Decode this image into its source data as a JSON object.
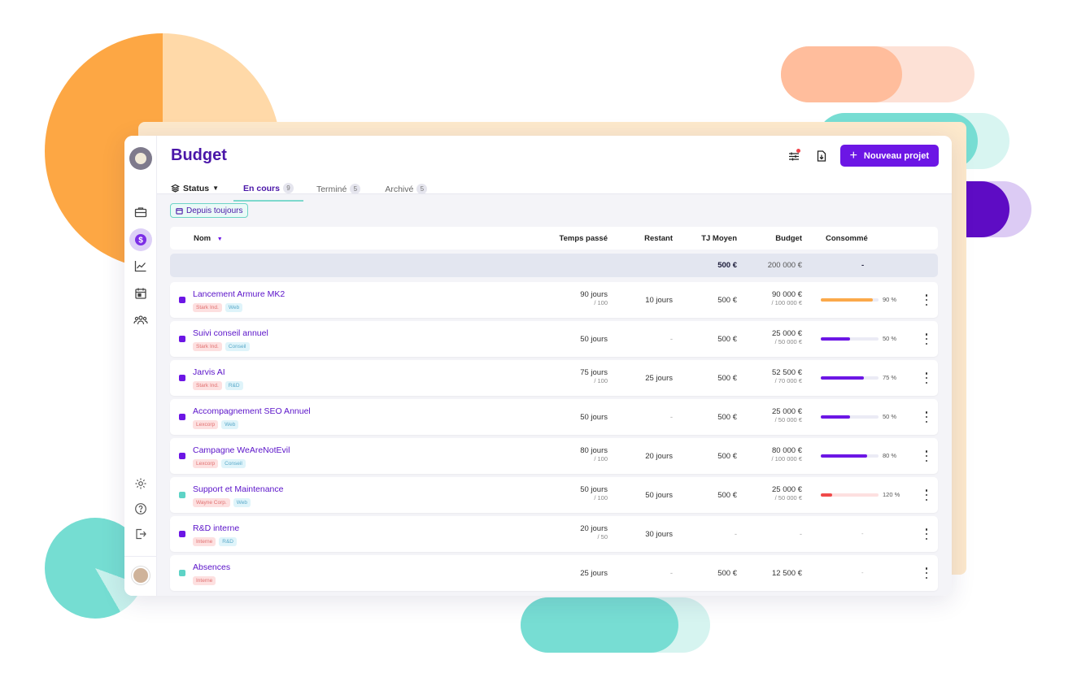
{
  "header": {
    "title": "Budget",
    "new_project_label": "Nouveau projet"
  },
  "tabs": {
    "status_label": "Status",
    "items": [
      {
        "label": "En cours",
        "count": "9"
      },
      {
        "label": "Terminé",
        "count": "5"
      },
      {
        "label": "Archivé",
        "count": "5"
      }
    ]
  },
  "filter": {
    "label": "Depuis toujours"
  },
  "columns": {
    "name": "Nom",
    "time_spent": "Temps passé",
    "remaining": "Restant",
    "avg_rate": "TJ Moyen",
    "budget": "Budget",
    "consumed": "Consommé"
  },
  "totals": {
    "avg_rate": "500 €",
    "budget": "200 000 €",
    "consumed": "-"
  },
  "rows": [
    {
      "name": "Lancement Armure MK2",
      "client": "Stark Ind.",
      "type": "Web",
      "color": "#6c16e5",
      "time": "90 jours",
      "time_sub": "/ 100",
      "remaining": "10 jours",
      "rate": "500 €",
      "budget": "90 000 €",
      "budget_sub": "/ 100 000 €",
      "pct": "90 %",
      "progress": 0.9,
      "bar_color": "#fba94a"
    },
    {
      "name": "Suivi conseil annuel",
      "client": "Stark Ind.",
      "type": "Conseil",
      "color": "#6c16e5",
      "time": "50 jours",
      "time_sub": "",
      "remaining": "-",
      "rate": "500 €",
      "budget": "25 000 €",
      "budget_sub": "/ 50 000 €",
      "pct": "50 %",
      "progress": 0.5,
      "bar_color": "#6c16e5"
    },
    {
      "name": "Jarvis AI",
      "client": "Stark Ind.",
      "type": "R&D",
      "color": "#6c16e5",
      "time": "75 jours",
      "time_sub": "/ 100",
      "remaining": "25 jours",
      "rate": "500 €",
      "budget": "52 500 €",
      "budget_sub": "/ 70 000 €",
      "pct": "75 %",
      "progress": 0.75,
      "bar_color": "#6c16e5"
    },
    {
      "name": "Accompagnement SEO Annuel",
      "client": "Lexcorp",
      "type": "Web",
      "color": "#6c16e5",
      "time": "50 jours",
      "time_sub": "",
      "remaining": "-",
      "rate": "500 €",
      "budget": "25 000 €",
      "budget_sub": "/ 50 000 €",
      "pct": "50 %",
      "progress": 0.5,
      "bar_color": "#6c16e5"
    },
    {
      "name": "Campagne WeAreNotEvil",
      "client": "Lexcorp",
      "type": "Conseil",
      "color": "#6c16e5",
      "time": "80 jours",
      "time_sub": "/ 100",
      "remaining": "20 jours",
      "rate": "500 €",
      "budget": "80 000 €",
      "budget_sub": "/ 100 000 €",
      "pct": "80 %",
      "progress": 0.8,
      "bar_color": "#6c16e5"
    },
    {
      "name": "Support et Maintenance",
      "client": "Wayne Corp.",
      "type": "Web",
      "color": "#5ed3c6",
      "time": "50 jours",
      "time_sub": "/ 100",
      "remaining": "50 jours",
      "rate": "500 €",
      "budget": "25 000 €",
      "budget_sub": "/ 50 000 €",
      "pct": "120 %",
      "progress": 0.2,
      "bar_color": "#f04a4a",
      "track_color": "#fde0e0"
    },
    {
      "name": "R&D interne",
      "client": "Interne",
      "type": "R&D",
      "color": "#6c16e5",
      "time": "20 jours",
      "time_sub": "/ 50",
      "remaining": "30 jours",
      "rate": "-",
      "budget": "-",
      "budget_sub": "",
      "pct": "-",
      "progress": null,
      "bar_color": ""
    },
    {
      "name": "Absences",
      "client": "Interne",
      "type": "",
      "color": "#5ed3c6",
      "time": "25 jours",
      "time_sub": "",
      "remaining": "-",
      "rate": "500 €",
      "budget": "12 500 €",
      "budget_sub": "",
      "pct": "-",
      "progress": null,
      "bar_color": ""
    }
  ]
}
